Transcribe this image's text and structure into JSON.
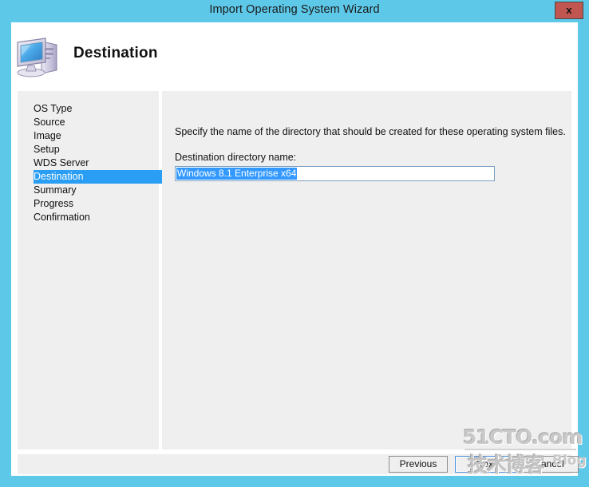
{
  "window": {
    "title": "Import Operating System Wizard",
    "close_label": "x",
    "frame_color": "#5ec8e8",
    "close_button_color": "#c0564f"
  },
  "header": {
    "title": "Destination",
    "icon": "computer-icon"
  },
  "sidebar": {
    "selected_index": 5,
    "highlight_color": "#2a9df4",
    "items": [
      {
        "label": "OS Type"
      },
      {
        "label": "Source"
      },
      {
        "label": "Image"
      },
      {
        "label": "Setup"
      },
      {
        "label": "WDS Server"
      },
      {
        "label": "Destination"
      },
      {
        "label": "Summary"
      },
      {
        "label": "Progress"
      },
      {
        "label": "Confirmation"
      }
    ]
  },
  "content": {
    "instruction": "Specify the name of the directory that should be created for these operating system files.",
    "field_label": "Destination directory name:",
    "directory_input": {
      "value": "Windows 8.1 Enterprise x64",
      "placeholder": "",
      "selected": true,
      "selection_color": "#3399ff"
    }
  },
  "buttons": {
    "previous": "Previous",
    "next": "Next",
    "cancel": "Cancel",
    "focused": "next"
  },
  "watermark": {
    "top": "51CTO.com",
    "chinese": "技术博客",
    "blog": "Blog"
  }
}
